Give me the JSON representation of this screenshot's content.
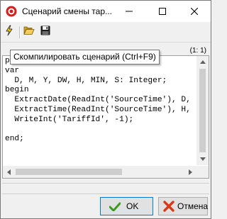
{
  "window": {
    "title": "Сценарий смены тар...",
    "icon": "app-record-icon",
    "accent": "#e81123"
  },
  "toolbar": {
    "buttons": [
      {
        "icon": "lightning-icon",
        "tooltip": "Скомпилировать сценарий (Ctrl+F9)"
      },
      {
        "icon": "folder-open-icon"
      },
      {
        "icon": "floppy-save-icon"
      }
    ]
  },
  "tooltip": {
    "text": "Скомпилировать сценарий (Ctrl+F9)"
  },
  "editor": {
    "position": "(1: 1)",
    "code": "procedure SelectTariff;\nvar\n  D, M, Y, DW, H, MIN, S: Integer;\nbegin\n  ExtractDate(ReadInt('SourceTime'), D,\n  ExtractTime(ReadInt('SourceTime'), H,\n  WriteInt('TariffId', -1);\n\nend;"
  },
  "buttons": {
    "ok_label": "OK",
    "cancel_label": "Отмена"
  }
}
